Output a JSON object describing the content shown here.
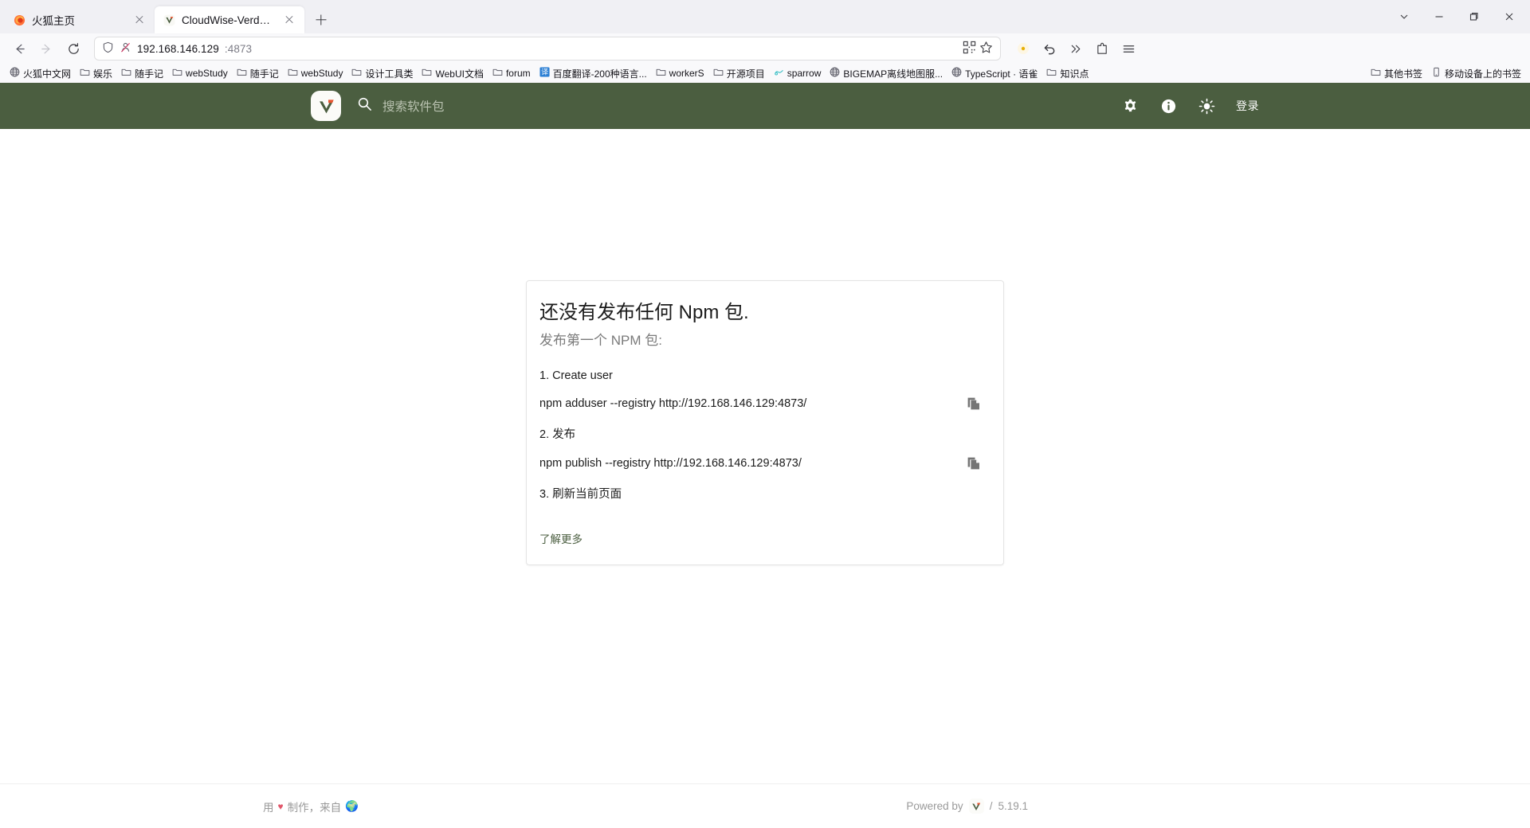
{
  "browser": {
    "tabs": [
      {
        "title": "火狐主页",
        "favicon": "firefox-icon",
        "active": false
      },
      {
        "title": "CloudWise-Verdaccio",
        "favicon": "verdaccio-icon",
        "active": true
      }
    ],
    "new_tab_label": "+",
    "window_controls": [
      "tab-list-chevron-icon",
      "minimize-icon",
      "maximize-icon",
      "close-icon"
    ],
    "nav": {
      "back": "back-arrow-icon",
      "forward": "forward-arrow-icon",
      "reload": "reload-icon"
    },
    "url": {
      "host": "192.168.146.129",
      "port": ":4873",
      "shield_icon": "shield-icon",
      "permission_icon": "blocked-permission-icon",
      "qr_icon": "qr-code-icon",
      "bookmark_star_icon": "star-icon"
    },
    "toolbar_right": [
      "account-dot-icon",
      "undo-arrow-icon",
      "overflow-chevrons-icon",
      "extensions-icon",
      "app-menu-icon"
    ],
    "bookmarks": [
      {
        "label": "火狐中文网",
        "icon": "globe-icon"
      },
      {
        "label": "娱乐",
        "icon": "folder-icon"
      },
      {
        "label": "随手记",
        "icon": "folder-icon"
      },
      {
        "label": "webStudy",
        "icon": "folder-icon"
      },
      {
        "label": "随手记",
        "icon": "folder-icon"
      },
      {
        "label": "webStudy",
        "icon": "folder-icon"
      },
      {
        "label": "设计工具类",
        "icon": "folder-icon"
      },
      {
        "label": "WebUI文档",
        "icon": "folder-icon"
      },
      {
        "label": "forum",
        "icon": "folder-icon"
      },
      {
        "label": "百度翻译-200种语言...",
        "icon": "baidu-translate-icon"
      },
      {
        "label": "workerS",
        "icon": "folder-icon"
      },
      {
        "label": "开源项目",
        "icon": "folder-icon"
      },
      {
        "label": "sparrow",
        "icon": "sparrow-icon"
      },
      {
        "label": "BIGEMAP离线地图服...",
        "icon": "globe-icon"
      },
      {
        "label": "TypeScript · 语雀",
        "icon": "globe-icon"
      },
      {
        "label": "知识点",
        "icon": "folder-icon"
      }
    ],
    "bookmarks_right": [
      {
        "label": "其他书签",
        "icon": "folder-icon"
      },
      {
        "label": "移动设备上的书签",
        "icon": "mobile-icon"
      }
    ]
  },
  "app": {
    "header": {
      "logo": "verdaccio-logo",
      "search_icon": "search-icon",
      "search_placeholder": "搜索软件包",
      "search_value": "",
      "settings_icon": "gear-icon",
      "info_icon": "info-icon",
      "theme_icon": "sun-icon",
      "login_label": "登录",
      "background_color": "#4b5e40"
    },
    "card": {
      "title": "还没有发布任何 Npm 包.",
      "subtitle": "发布第一个 NPM 包:",
      "steps": [
        {
          "label": "1. Create user",
          "command": "npm adduser --registry http://192.168.146.129:4873/",
          "copy_icon": "copy-icon"
        },
        {
          "label": "2. 发布",
          "command": "npm publish --registry http://192.168.146.129:4873/",
          "copy_icon": "copy-icon"
        },
        {
          "label": "3. 刷新当前页面",
          "command": null,
          "copy_icon": null
        }
      ],
      "learn_more_label": "了解更多",
      "link_color": "#4b5e40"
    },
    "footer": {
      "made_with_prefix": "用",
      "heart": "♥",
      "made_with_suffix": "制作，来自",
      "globe_emoji": "🌍",
      "powered_by_label": "Powered by",
      "separator": "/",
      "version": "5.19.1"
    }
  }
}
